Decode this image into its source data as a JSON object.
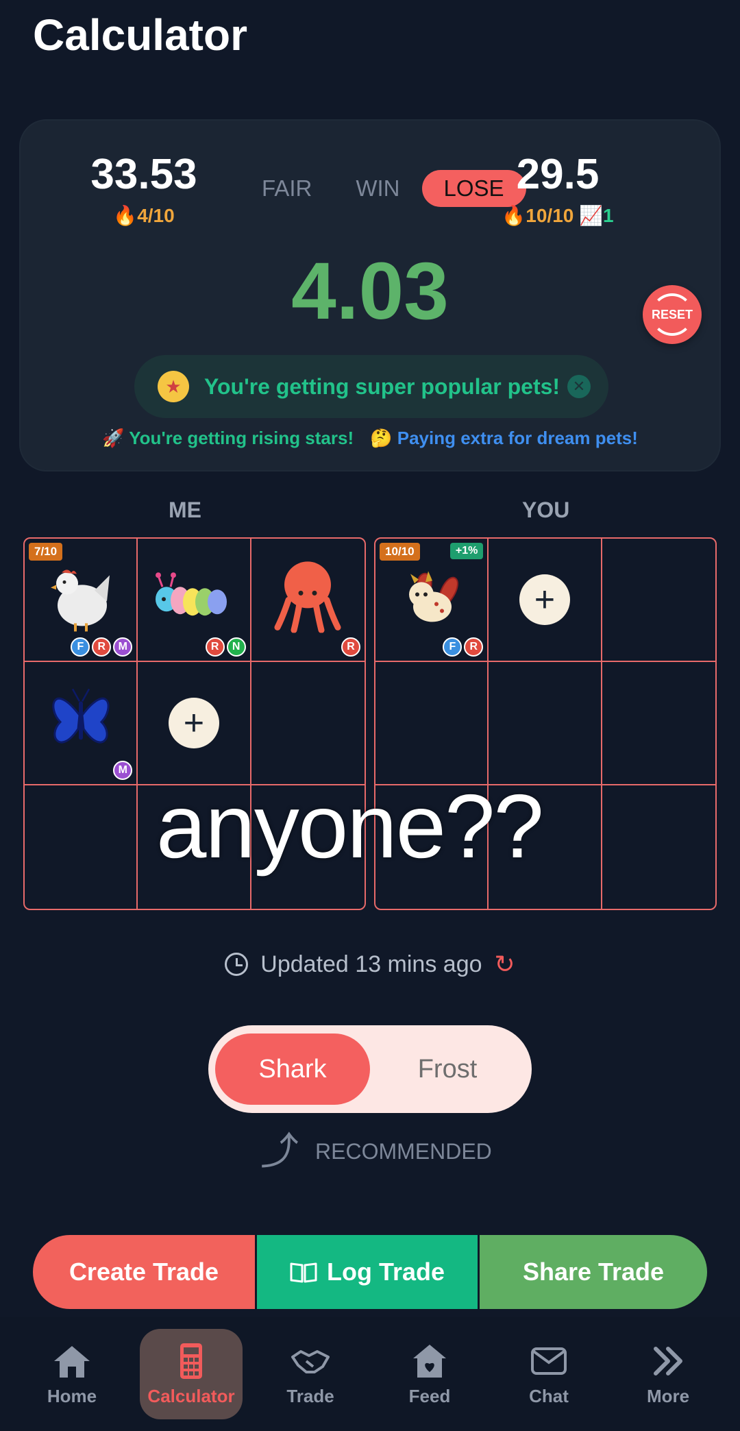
{
  "header": {
    "title": "Calculator"
  },
  "summary": {
    "left_value": "33.53",
    "left_demand": "4/10",
    "right_value": "29.5",
    "right_demand": "10/10",
    "right_trend": "1",
    "status_tabs": [
      "FAIR",
      "WIN",
      "LOSE"
    ],
    "active_status": "LOSE",
    "difference": "4.03",
    "reset_label": "RESET",
    "banner_text": "You're getting super popular pets!",
    "insight_1": "You're getting rising stars!",
    "insight_2": "Paying extra for dream pets!"
  },
  "sides": {
    "me": "ME",
    "you": "YOU"
  },
  "me_grid": {
    "cell1": {
      "badge": "7/10",
      "tags": [
        "F",
        "R",
        "M"
      ],
      "pet": "chicken"
    },
    "cell2": {
      "tags": [
        "R",
        "N"
      ],
      "pet": "caterpillar"
    },
    "cell3": {
      "tags": [
        "R"
      ],
      "pet": "octopus"
    },
    "cell4": {
      "tags": [
        "M"
      ],
      "pet": "butterfly"
    }
  },
  "you_grid": {
    "cell1": {
      "badge": "10/10",
      "badge_right": "+1%",
      "tags": [
        "F",
        "R"
      ],
      "pet": "dragon"
    }
  },
  "overlay": {
    "text": "anyone??"
  },
  "updated": {
    "text": "Updated 13 mins ago"
  },
  "value_toggle": {
    "options": [
      "Shark",
      "Frost"
    ],
    "active": "Shark"
  },
  "recommended": {
    "label": "RECOMMENDED"
  },
  "actions": {
    "create": "Create Trade",
    "log": "Log Trade",
    "share": "Share Trade"
  },
  "nav": {
    "items": [
      {
        "label": "Home",
        "icon": "home-icon"
      },
      {
        "label": "Calculator",
        "icon": "calculator-icon"
      },
      {
        "label": "Trade",
        "icon": "handshake-icon"
      },
      {
        "label": "Feed",
        "icon": "feed-icon"
      },
      {
        "label": "Chat",
        "icon": "mail-icon"
      },
      {
        "label": "More",
        "icon": "chevrons-right-icon"
      }
    ],
    "active": "Calculator"
  },
  "colors": {
    "accent": "#f4605f",
    "green": "#5db36a",
    "teal": "#14b882",
    "background": "#101828"
  }
}
